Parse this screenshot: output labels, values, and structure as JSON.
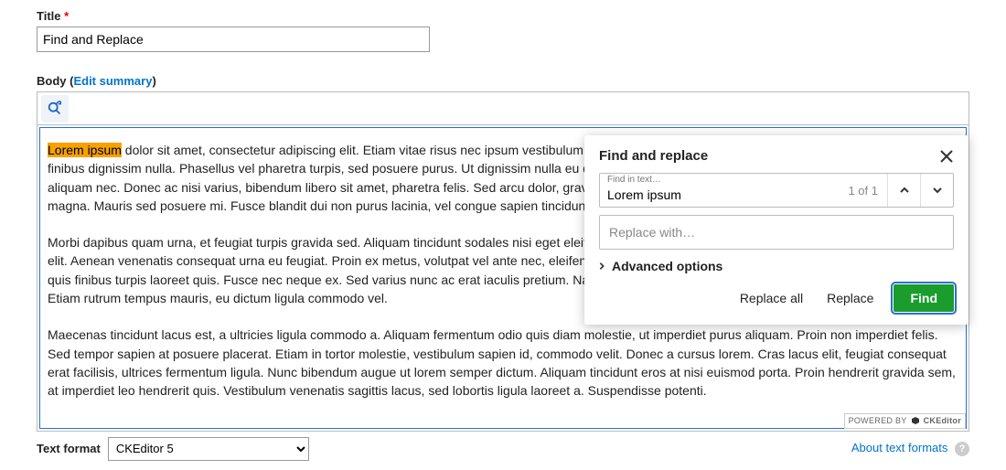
{
  "title_field": {
    "label": "Title",
    "required": "*",
    "value": "Find and Replace"
  },
  "body_field": {
    "label": "Body",
    "edit_summary": "Edit summary"
  },
  "content": {
    "highlight": "Lorem ipsum",
    "p1_rest": " dolor sit amet, consectetur adipiscing elit. Etiam vitae risus nec ipsum vestibulum porta vel id nulla. Integer cursus, felis eu ultrices varius. Integer finibus dignissim nulla. Phasellus vel pharetra turpis, sed posuere purus. Ut dignissim nulla eu quam auctor pretium. Morbi euismod tellus, non viverra enim aliquam nec. Donec ac nisi varius, bibendum libero sit amet, pharetra felis. Sed arcu dolor, gravida eget lorem et, imperdiet euismod at tempor nec, imperdiet eu magna. Mauris sed posuere mi. Fusce blandit dui non purus lacinia, vel congue sapien tincidunt. Morbi placerat sodales.",
    "p2": "Morbi dapibus quam urna, et feugiat turpis gravida sed. Aliquam tincidunt sodales nisi eget eleifend. Phasellus sollicitudin orci felis, eget lobortis ipsum sed nunc elit. Aenean venenatis consequat urna eu feugiat. Proin ex metus, volutpat vel ante nec, eleifend rhoncus purus. Ut tristique felis eget dolor posuere arcu nibh, quis finibus turpis laoreet quis. Fusce nec neque ex. Sed varius nunc ac erat iaculis pretium. Nam tincidunt hendrerit dui hendrerit risus dignissim imperdiet. Etiam rutrum tempus mauris, eu dictum ligula commodo vel.",
    "p3": "Maecenas tincidunt lacus est, a ultricies ligula commodo a. Aliquam fermentum odio quis diam molestie, ut imperdiet purus aliquam. Proin non imperdiet felis. Sed tempor sapien at posuere placerat. Etiam in tortor molestie, vestibulum sapien id, commodo velit. Donec a cursus lorem. Cras lacus elit, feugiat consequat erat facilisis, ultrices fermentum ligula. Nunc bibendum augue ut lorem semper dictum. Aliquam tincidunt eros at nisi euismod porta. Proin hendrerit gravida sem, at imperdiet leo hendrerit quis. Vestibulum venenatis sagittis lacus, sed lobortis ligula laoreet a. Suspendisse potenti."
  },
  "popup": {
    "title": "Find and replace",
    "find_label": "Find in text…",
    "find_value": "Lorem ipsum",
    "count": "1 of 1",
    "replace_placeholder": "Replace with…",
    "advanced": "Advanced options",
    "replace_all": "Replace all",
    "replace": "Replace",
    "find": "Find"
  },
  "powered": {
    "label": "POWERED BY",
    "brand": "CKEditor"
  },
  "footer": {
    "format_label": "Text format",
    "format_value": "CKEditor 5",
    "about": "About text formats"
  }
}
